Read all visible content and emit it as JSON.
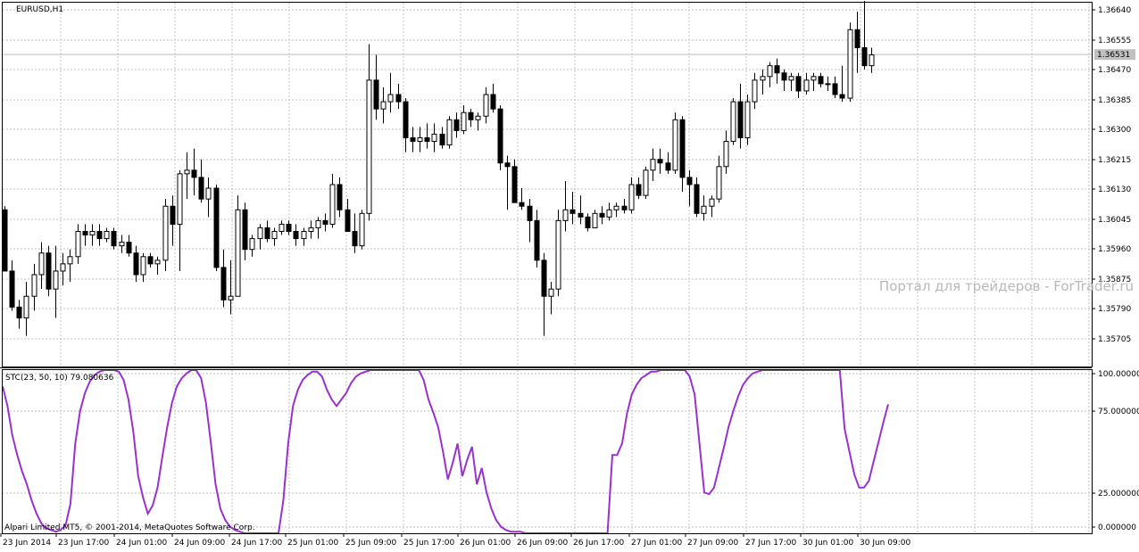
{
  "window": {
    "symbol_label": "EURUSD,H1",
    "watermark": "Портал для трейдеров - ForTrader.ru",
    "copyright": "Alpari Limited MT5, © 2001-2014, MetaQuotes Software Corp."
  },
  "colors": {
    "background": "#ffffff",
    "grid": "#c0c0c0",
    "candle_bull_fill": "#ffffff",
    "candle_bear_fill": "#000000",
    "candle_outline": "#000000",
    "indicator_line": "#9932cc",
    "current_price_line": "#c0c0c0",
    "price_tag_bg": "#c0c0c0"
  },
  "chart_data": [
    {
      "type": "candlestick",
      "panel": "price",
      "ylim": [
        1.35665,
        1.36675
      ],
      "y_ticks": [
        "1.36640",
        "1.36555",
        "1.36470",
        "1.36385",
        "1.36300",
        "1.36215",
        "1.36130",
        "1.36045",
        "1.35960",
        "1.35875",
        "1.35790",
        "1.35705"
      ],
      "x_labels": [
        "23 Jun 2014",
        "23 Jun 17:00",
        "24 Jun 01:00",
        "24 Jun 09:00",
        "24 Jun 17:00",
        "25 Jun 01:00",
        "25 Jun 09:00",
        "25 Jun 17:00",
        "26 Jun 01:00",
        "26 Jun 09:00",
        "26 Jun 17:00",
        "27 Jun 01:00",
        "27 Jun 09:00",
        "27 Jun 17:00",
        "30 Jun 01:00",
        "30 Jun 09:00"
      ],
      "current_price": 1.36531,
      "current_price_label": "1.36531",
      "grid": true,
      "ohlc": [
        [
          1.361,
          1.3611,
          1.3593,
          1.3593
        ],
        [
          1.3593,
          1.3596,
          1.3582,
          1.3583
        ],
        [
          1.3583,
          1.3585,
          1.3577,
          1.358
        ],
        [
          1.358,
          1.359,
          1.3575,
          1.3586
        ],
        [
          1.3586,
          1.3595,
          1.3582,
          1.3592
        ],
        [
          1.3592,
          1.3601,
          1.3588,
          1.3598
        ],
        [
          1.3598,
          1.36,
          1.3586,
          1.3588
        ],
        [
          1.3588,
          1.36,
          1.358,
          1.3593
        ],
        [
          1.3593,
          1.3598,
          1.3589,
          1.3595
        ],
        [
          1.3595,
          1.3599,
          1.359,
          1.3597
        ],
        [
          1.3597,
          1.3606,
          1.3595,
          1.3604
        ],
        [
          1.3604,
          1.3606,
          1.36,
          1.3603
        ],
        [
          1.3603,
          1.3606,
          1.36,
          1.3604
        ],
        [
          1.3604,
          1.3606,
          1.36,
          1.3602
        ],
        [
          1.3602,
          1.3605,
          1.3601,
          1.3604
        ],
        [
          1.3604,
          1.3605,
          1.3599,
          1.36
        ],
        [
          1.36,
          1.3603,
          1.3598,
          1.3601
        ],
        [
          1.3601,
          1.3603,
          1.3597,
          1.3598
        ],
        [
          1.3598,
          1.36,
          1.359,
          1.3592
        ],
        [
          1.3592,
          1.3598,
          1.359,
          1.3597
        ],
        [
          1.3597,
          1.3598,
          1.3594,
          1.3595
        ],
        [
          1.3595,
          1.3597,
          1.3592,
          1.3596
        ],
        [
          1.3596,
          1.3613,
          1.3593,
          1.3611
        ],
        [
          1.3611,
          1.3614,
          1.36,
          1.3606
        ],
        [
          1.3606,
          1.3621,
          1.3593,
          1.362
        ],
        [
          1.362,
          1.3626,
          1.3613,
          1.3621
        ],
        [
          1.3621,
          1.3627,
          1.3614,
          1.3619
        ],
        [
          1.3619,
          1.3624,
          1.3612,
          1.3613
        ],
        [
          1.3613,
          1.3619,
          1.3608,
          1.3616
        ],
        [
          1.3616,
          1.3617,
          1.3593,
          1.3594
        ],
        [
          1.3594,
          1.3599,
          1.3583,
          1.3585
        ],
        [
          1.3585,
          1.3596,
          1.3581,
          1.3586
        ],
        [
          1.3586,
          1.3614,
          1.3586,
          1.361
        ],
        [
          1.361,
          1.3612,
          1.3596,
          1.3599
        ],
        [
          1.3599,
          1.3603,
          1.3597,
          1.3602
        ],
        [
          1.3602,
          1.3606,
          1.3599,
          1.3605
        ],
        [
          1.3605,
          1.3607,
          1.3601,
          1.3602
        ],
        [
          1.3602,
          1.3605,
          1.36,
          1.3604
        ],
        [
          1.3604,
          1.3607,
          1.3603,
          1.3606
        ],
        [
          1.3606,
          1.3607,
          1.3603,
          1.3604
        ],
        [
          1.3604,
          1.3606,
          1.36,
          1.3602
        ],
        [
          1.3602,
          1.3605,
          1.36,
          1.3604
        ],
        [
          1.3604,
          1.3607,
          1.3602,
          1.3605
        ],
        [
          1.3605,
          1.3608,
          1.3602,
          1.3607
        ],
        [
          1.3607,
          1.3609,
          1.3604,
          1.3606
        ],
        [
          1.3606,
          1.362,
          1.3605,
          1.3617
        ],
        [
          1.3617,
          1.3619,
          1.3608,
          1.361
        ],
        [
          1.361,
          1.3613,
          1.3604,
          1.3604
        ],
        [
          1.3604,
          1.3609,
          1.3598,
          1.36
        ],
        [
          1.36,
          1.361,
          1.3599,
          1.3609
        ],
        [
          1.3609,
          1.3656,
          1.3607,
          1.3646
        ],
        [
          1.3646,
          1.3653,
          1.3635,
          1.3638
        ],
        [
          1.3638,
          1.3644,
          1.3634,
          1.364
        ],
        [
          1.364,
          1.3648,
          1.3637,
          1.3642
        ],
        [
          1.3642,
          1.3645,
          1.3638,
          1.364
        ],
        [
          1.364,
          1.3641,
          1.3626,
          1.363
        ],
        [
          1.363,
          1.3633,
          1.3626,
          1.3629
        ],
        [
          1.3629,
          1.3633,
          1.3626,
          1.363
        ],
        [
          1.363,
          1.3634,
          1.3627,
          1.3629
        ],
        [
          1.3629,
          1.3634,
          1.3626,
          1.3631
        ],
        [
          1.3631,
          1.3633,
          1.3627,
          1.3628
        ],
        [
          1.3628,
          1.3636,
          1.3627,
          1.3635
        ],
        [
          1.3635,
          1.3637,
          1.363,
          1.3632
        ],
        [
          1.3632,
          1.3639,
          1.3631,
          1.3637
        ],
        [
          1.3637,
          1.3638,
          1.3633,
          1.3635
        ],
        [
          1.3635,
          1.3637,
          1.3632,
          1.3636
        ],
        [
          1.3636,
          1.3644,
          1.3634,
          1.3642
        ],
        [
          1.3642,
          1.3645,
          1.3637,
          1.3638
        ],
        [
          1.3638,
          1.3639,
          1.3621,
          1.3623
        ],
        [
          1.3623,
          1.3625,
          1.361,
          1.3622
        ],
        [
          1.3622,
          1.3624,
          1.3612,
          1.3612
        ],
        [
          1.3612,
          1.3616,
          1.361,
          1.3611
        ],
        [
          1.3611,
          1.3613,
          1.3601,
          1.3607
        ],
        [
          1.3607,
          1.361,
          1.3594,
          1.3596
        ],
        [
          1.3596,
          1.3598,
          1.3575,
          1.3586
        ],
        [
          1.3586,
          1.359,
          1.3581,
          1.3588
        ],
        [
          1.3588,
          1.361,
          1.3586,
          1.3607
        ],
        [
          1.3607,
          1.3618,
          1.3604,
          1.361
        ],
        [
          1.361,
          1.3615,
          1.3606,
          1.3609
        ],
        [
          1.3609,
          1.3614,
          1.3606,
          1.3608
        ],
        [
          1.3608,
          1.3609,
          1.3604,
          1.3605
        ],
        [
          1.3605,
          1.361,
          1.3605,
          1.3609
        ],
        [
          1.3609,
          1.3611,
          1.3606,
          1.3608
        ],
        [
          1.3608,
          1.3612,
          1.3607,
          1.361
        ],
        [
          1.361,
          1.3612,
          1.3608,
          1.3611
        ],
        [
          1.3611,
          1.3613,
          1.3609,
          1.361
        ],
        [
          1.361,
          1.3619,
          1.3609,
          1.3617
        ],
        [
          1.3617,
          1.3619,
          1.3613,
          1.3614
        ],
        [
          1.3614,
          1.3622,
          1.3613,
          1.3621
        ],
        [
          1.3621,
          1.3627,
          1.3618,
          1.3624
        ],
        [
          1.3624,
          1.3627,
          1.362,
          1.3623
        ],
        [
          1.3623,
          1.3626,
          1.362,
          1.3621
        ],
        [
          1.3621,
          1.3637,
          1.362,
          1.3635
        ],
        [
          1.3635,
          1.3636,
          1.3615,
          1.3619
        ],
        [
          1.3619,
          1.3621,
          1.3611,
          1.3617
        ],
        [
          1.3617,
          1.3619,
          1.3608,
          1.3609
        ],
        [
          1.3609,
          1.3614,
          1.3607,
          1.3611
        ],
        [
          1.3611,
          1.3614,
          1.3608,
          1.3613
        ],
        [
          1.3613,
          1.3625,
          1.3612,
          1.3622
        ],
        [
          1.3622,
          1.3632,
          1.362,
          1.3629
        ],
        [
          1.3629,
          1.3641,
          1.3628,
          1.364
        ],
        [
          1.364,
          1.3645,
          1.3627,
          1.363
        ],
        [
          1.363,
          1.3642,
          1.3628,
          1.364
        ],
        [
          1.364,
          1.3648,
          1.3638,
          1.3646
        ],
        [
          1.3646,
          1.3649,
          1.3642,
          1.3647
        ],
        [
          1.3647,
          1.3651,
          1.3644,
          1.365
        ],
        [
          1.365,
          1.3652,
          1.3645,
          1.3648
        ],
        [
          1.3648,
          1.3649,
          1.3643,
          1.3646
        ],
        [
          1.3646,
          1.3648,
          1.3643,
          1.3647
        ],
        [
          1.3647,
          1.3648,
          1.3641,
          1.3643
        ],
        [
          1.3643,
          1.3648,
          1.3642,
          1.3646
        ],
        [
          1.3646,
          1.3648,
          1.3643,
          1.3647
        ],
        [
          1.3647,
          1.3648,
          1.3644,
          1.3645
        ],
        [
          1.3645,
          1.3647,
          1.3643,
          1.3645
        ],
        [
          1.3645,
          1.3647,
          1.3641,
          1.3642
        ],
        [
          1.3642,
          1.365,
          1.364,
          1.3641
        ],
        [
          1.3641,
          1.3662,
          1.364,
          1.366
        ],
        [
          1.366,
          1.3665,
          1.3648,
          1.3655
        ],
        [
          1.3655,
          1.3668,
          1.3649,
          1.365
        ],
        [
          1.365,
          1.3655,
          1.3648,
          1.3653
        ]
      ]
    },
    {
      "type": "line",
      "panel": "indicator",
      "label": "STC(23, 50, 10) 79.080636",
      "ylim": [
        0,
        100
      ],
      "y_ticks": [
        "100.000000",
        "75.000000",
        "25.000000",
        "0.000000"
      ],
      "series": [
        {
          "values": [
            90,
            78,
            60,
            48,
            38,
            30,
            20,
            12,
            6,
            3,
            2,
            1,
            2,
            5,
            18,
            55,
            75,
            86,
            93,
            97,
            99,
            100,
            100,
            100,
            99,
            94,
            82,
            62,
            35,
            22,
            12,
            17,
            28,
            47,
            65,
            80,
            90,
            95,
            98,
            100,
            100,
            95,
            80,
            56,
            30,
            15,
            8,
            4,
            2,
            1,
            0,
            0,
            0,
            0,
            0,
            0,
            0,
            0,
            20,
            55,
            78,
            88,
            94,
            97,
            99,
            99,
            96,
            88,
            82,
            78,
            82,
            86,
            92,
            96,
            98,
            99,
            100,
            100,
            100,
            100,
            100,
            100,
            100,
            100,
            100,
            100,
            100,
            94,
            82,
            74,
            65,
            50,
            33,
            43,
            55,
            35,
            45,
            53,
            30,
            40,
            25,
            15,
            8,
            4,
            2,
            1,
            1,
            1,
            0,
            0,
            0,
            0,
            0,
            0,
            0,
            0,
            0,
            0,
            0,
            0,
            0,
            0,
            0,
            0,
            0,
            0,
            48,
            48,
            55,
            73,
            85,
            91,
            95,
            97,
            99,
            99,
            100,
            100,
            100,
            100,
            100,
            100,
            96,
            85,
            55,
            25,
            24,
            28,
            40,
            52,
            65,
            75,
            84,
            91,
            95,
            98,
            99,
            100,
            100,
            100,
            100,
            100,
            100,
            100,
            100,
            100,
            100,
            100,
            100,
            100,
            100,
            100,
            100,
            100,
            64,
            50,
            36,
            28,
            28,
            32,
            44,
            56,
            68,
            79
          ]
        }
      ]
    }
  ]
}
